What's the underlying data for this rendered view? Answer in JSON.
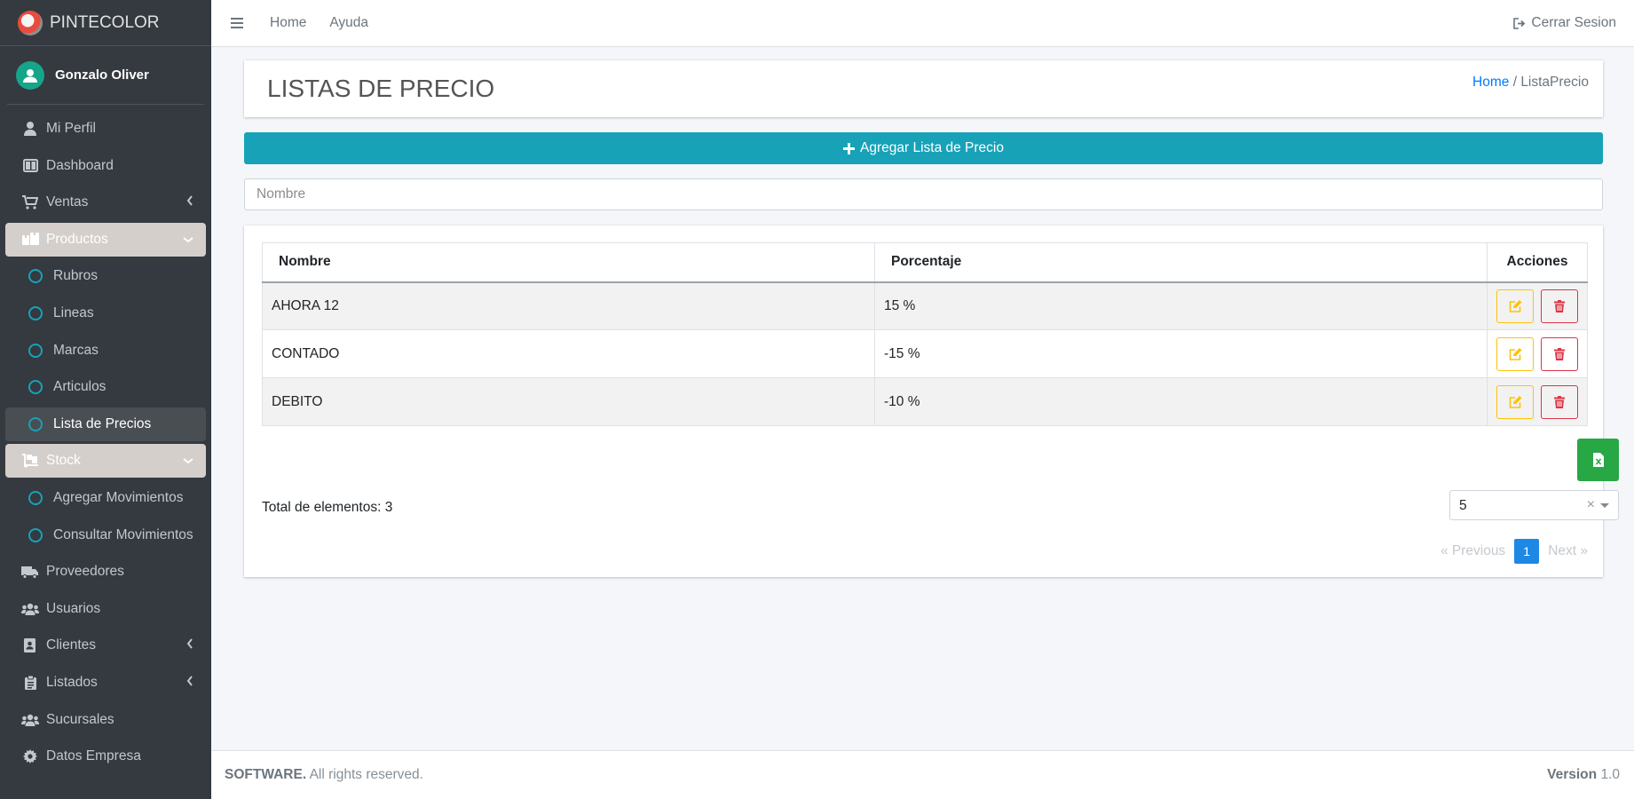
{
  "brand": {
    "name": "PINTECOLOR"
  },
  "user": {
    "name": "Gonzalo Oliver"
  },
  "sidebar": {
    "items": [
      {
        "label": "Mi Perfil",
        "icon": "user-icon"
      },
      {
        "label": "Dashboard",
        "icon": "dashboard-icon"
      },
      {
        "label": "Ventas",
        "icon": "cart-icon"
      },
      {
        "label": "Productos",
        "icon": "boxes-icon"
      },
      {
        "label": "Rubros",
        "icon": "circle-icon"
      },
      {
        "label": "Lineas",
        "icon": "circle-icon"
      },
      {
        "label": "Marcas",
        "icon": "circle-icon"
      },
      {
        "label": "Articulos",
        "icon": "circle-icon"
      },
      {
        "label": "Lista de Precios",
        "icon": "circle-icon"
      },
      {
        "label": "Stock",
        "icon": "dolly-icon"
      },
      {
        "label": "Agregar Movimientos",
        "icon": "circle-icon"
      },
      {
        "label": "Consultar Movimientos",
        "icon": "circle-icon"
      },
      {
        "label": "Proveedores",
        "icon": "truck-icon"
      },
      {
        "label": "Usuarios",
        "icon": "users-icon"
      },
      {
        "label": "Clientes",
        "icon": "address-book-icon"
      },
      {
        "label": "Listados",
        "icon": "clipboard-icon"
      },
      {
        "label": "Sucursales",
        "icon": "users-icon"
      },
      {
        "label": "Datos Empresa",
        "icon": "gear-icon"
      }
    ]
  },
  "topbar": {
    "home": "Home",
    "help": "Ayuda",
    "logout": "Cerrar Sesion"
  },
  "page": {
    "title": "LISTAS DE PRECIO",
    "breadcrumb_home": "Home",
    "breadcrumb_sep": "/",
    "breadcrumb_current": "ListaPrecio",
    "add_button": "Agregar Lista de Precio",
    "search_placeholder": "Nombre"
  },
  "table": {
    "headers": {
      "name": "Nombre",
      "percent": "Porcentaje",
      "actions": "Acciones"
    },
    "rows": [
      {
        "name": "AHORA 12",
        "percent": "15 %"
      },
      {
        "name": "CONTADO",
        "percent": "-15 %"
      },
      {
        "name": "DEBITO",
        "percent": "-10 %"
      }
    ]
  },
  "footer_table": {
    "total": "Total de elementos: 3",
    "page_size": "5",
    "clear": "×",
    "prev": "«  Previous",
    "page": "1",
    "next": "Next  »"
  },
  "footer": {
    "brand": "SOFTWARE.",
    "rights": "All rights reserved.",
    "version_label": "Version",
    "version": "1.0"
  },
  "colors": {
    "sidebar": "#343a40",
    "accent": "#17a2b8",
    "edit": "#ffc107",
    "delete": "#dc3545",
    "excel": "#28a745",
    "page": "#1e88e5"
  }
}
